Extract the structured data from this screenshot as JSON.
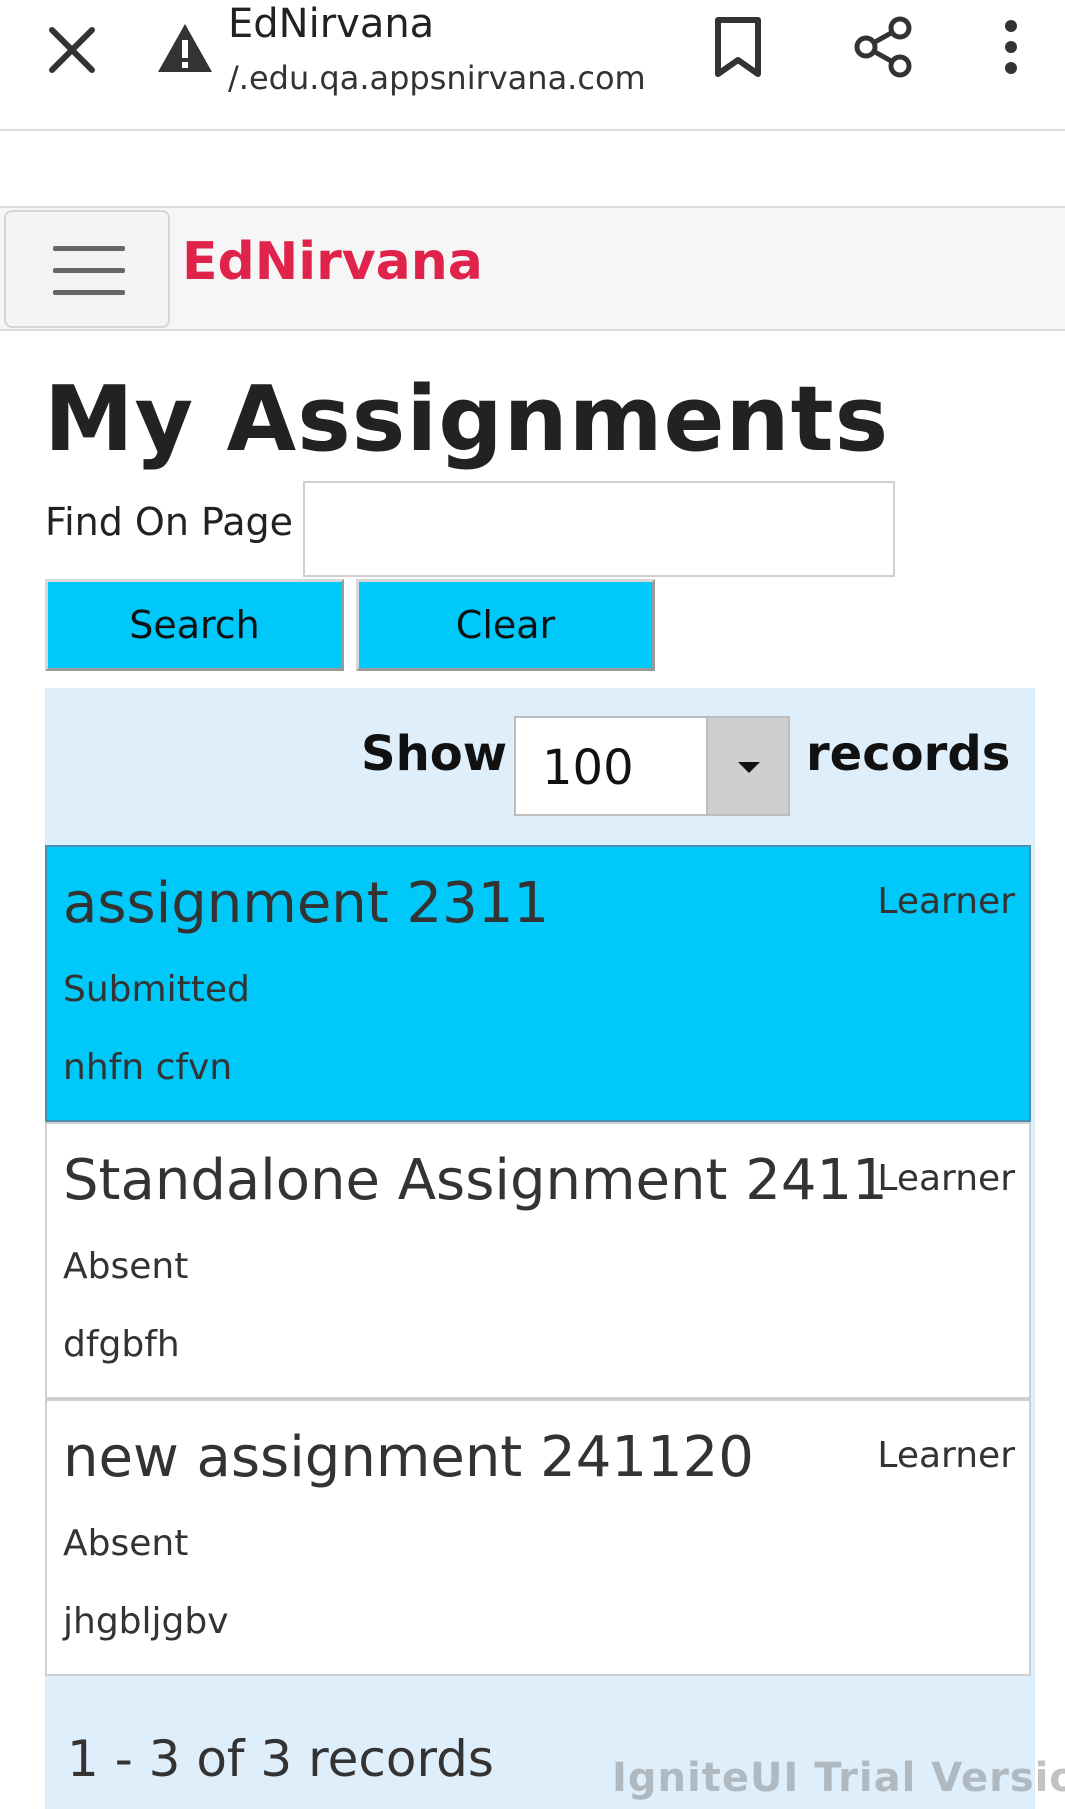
{
  "browser": {
    "title": "EdNirvana",
    "url": "/.edu.qa.appsnirvana.com"
  },
  "app": {
    "brand": "EdNirvana"
  },
  "page": {
    "title": "My Assignments",
    "find_label": "Find On Page",
    "find_value": "",
    "search_button": "Search",
    "clear_button": "Clear"
  },
  "grid": {
    "show_label": "Show",
    "page_size": "100",
    "records_label": "records",
    "items": [
      {
        "name": "assignment 2311",
        "role": "Learner",
        "status": "Submitted",
        "description": "nhfn cfvn",
        "selected": true
      },
      {
        "name": "Standalone Assignment 2411",
        "role": "Learner",
        "status": "Absent",
        "description": "dfgbfh",
        "selected": false
      },
      {
        "name": "new assignment 241120",
        "role": "Learner",
        "status": "Absent",
        "description": "jhgbljgbv",
        "selected": false
      }
    ],
    "pager_text": "1 - 3 of 3 records"
  },
  "watermark": "IgniteUI Trial Version",
  "colors": {
    "brand": "#e0234a",
    "accent": "#00c8f8",
    "grid_background": "#dfeefb"
  },
  "icons": {
    "close": "close-icon",
    "warning": "warning-icon",
    "bookmark": "bookmark-icon",
    "share": "share-icon",
    "more": "more-vertical-icon",
    "menu": "hamburger-menu-icon",
    "dropdown": "chevron-down-icon"
  }
}
